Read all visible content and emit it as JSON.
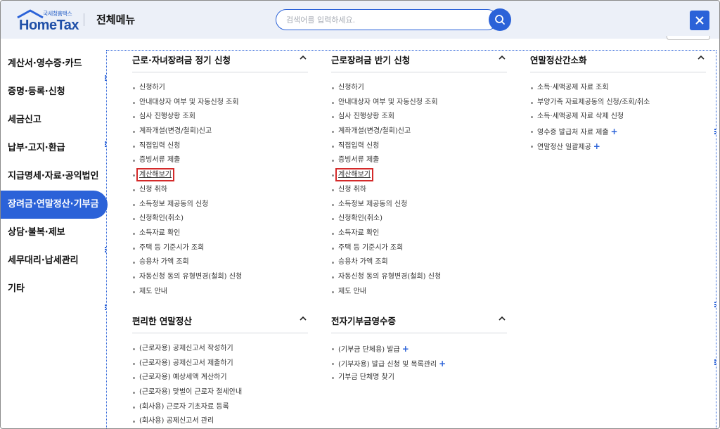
{
  "header": {
    "logo_small": "국세청홈택스",
    "logo_big": "HomeTax",
    "title": "전체메뉴",
    "search_placeholder": "검색어를 입력하세요.",
    "accent": "#2b62d8"
  },
  "sidebar": {
    "items": [
      {
        "label": "계산서·영수증·카드",
        "active": false
      },
      {
        "label": "증명·등록·신청",
        "active": false
      },
      {
        "label": "세금신고",
        "active": false
      },
      {
        "label": "납부·고지·환급",
        "active": false
      },
      {
        "label": "지급명세·자료·공익법인",
        "active": false
      },
      {
        "label": "장려금·연말정산·기부금",
        "active": true
      },
      {
        "label": "상담·불복·제보",
        "active": false
      },
      {
        "label": "세무대리·납세관리",
        "active": false
      },
      {
        "label": "기타",
        "active": false
      }
    ]
  },
  "sections": [
    {
      "title": "근로·자녀장려금 정기 신청",
      "items": [
        {
          "label": "신청하기"
        },
        {
          "label": "안내대상자 여부 및 자동신청 조회"
        },
        {
          "label": "심사 진행상황 조회"
        },
        {
          "label": "계좌개설(변경/철회)신고"
        },
        {
          "label": "직접입력 신청"
        },
        {
          "label": "증빙서류 제출"
        },
        {
          "label": "계산해보기",
          "highlighted": true
        },
        {
          "label": "신청 취하"
        },
        {
          "label": "소득정보 제공동의 신청"
        },
        {
          "label": "신청확인(취소)"
        },
        {
          "label": "소득자료 확인"
        },
        {
          "label": "주택 등 기준시가 조회"
        },
        {
          "label": "승용차 가액 조회"
        },
        {
          "label": "자동신청 동의 유형변경(철회) 신청"
        },
        {
          "label": "제도 안내"
        }
      ]
    },
    {
      "title": "근로장려금 반기 신청",
      "items": [
        {
          "label": "신청하기"
        },
        {
          "label": "안내대상자 여부 및 자동신청 조회"
        },
        {
          "label": "심사 진행상황 조회"
        },
        {
          "label": "계좌개설(변경/철회)신고"
        },
        {
          "label": "직접입력 신청"
        },
        {
          "label": "증빙서류 제출"
        },
        {
          "label": "계산해보기",
          "highlighted": true
        },
        {
          "label": "신청 취하"
        },
        {
          "label": "소득정보 제공동의 신청"
        },
        {
          "label": "신청확인(취소)"
        },
        {
          "label": "소득자료 확인"
        },
        {
          "label": "주택 등 기준시가 조회"
        },
        {
          "label": "승용차 가액 조회"
        },
        {
          "label": "자동신청 동의 유형변경(철회) 신청"
        },
        {
          "label": "제도 안내"
        }
      ]
    },
    {
      "title": "연말정산간소화",
      "items": [
        {
          "label": "소득·세액공제 자료 조회"
        },
        {
          "label": "부양가족 자료제공동의 신청/조회/취소"
        },
        {
          "label": "소득·세액공제 자료 삭제 신청"
        },
        {
          "label": "영수증 발급처 자료 제출",
          "plus": "+"
        },
        {
          "label": "연말정산 일괄제공",
          "plus": "+"
        }
      ]
    },
    {
      "title": "편리한 연말정산",
      "items": [
        {
          "label": "(근로자용) 공제신고서 작성하기"
        },
        {
          "label": "(근로자용) 공제신고서 제출하기"
        },
        {
          "label": "(근로자용) 예상세액 계산하기"
        },
        {
          "label": "(근로자용) 맞벌이 근로자 절세안내"
        },
        {
          "label": "(회사용) 근로자 기초자료 등록"
        },
        {
          "label": "(회사용) 공제신고서 관리"
        }
      ]
    },
    {
      "title": "전자기부금영수증",
      "items": [
        {
          "label": "(기부금 단체용) 발급",
          "plus": "+"
        },
        {
          "label": "(기부자용) 발급 신청 및 목록관리",
          "plus": "+"
        },
        {
          "label": "기부금 단체명 찾기"
        }
      ]
    }
  ]
}
